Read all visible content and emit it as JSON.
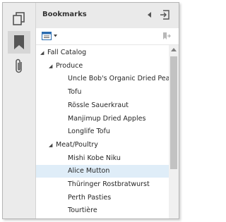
{
  "rail": {
    "buttons": [
      {
        "name": "thumbnails-icon"
      },
      {
        "name": "bookmark-icon"
      },
      {
        "name": "attachment-icon"
      }
    ]
  },
  "header": {
    "title": "Bookmarks"
  },
  "toolbar": {
    "options_icon": "bookmark-options-icon",
    "goto_icon": "go-to-bookmark-icon"
  },
  "tree": [
    {
      "label": "Fall Catalog",
      "level": 0,
      "caret": "expanded"
    },
    {
      "label": "Produce",
      "level": 1,
      "caret": "expanded"
    },
    {
      "label": "Uncle Bob's Organic Dried Pears",
      "level": 2
    },
    {
      "label": "Tofu",
      "level": 2
    },
    {
      "label": "Rössle Sauerkraut",
      "level": 2
    },
    {
      "label": "Manjimup Dried Apples",
      "level": 2
    },
    {
      "label": "Longlife Tofu",
      "level": 2
    },
    {
      "label": "Meat/Poultry",
      "level": 1,
      "caret": "expanded"
    },
    {
      "label": "Mishi Kobe Niku",
      "level": 2
    },
    {
      "label": "Alice Mutton",
      "level": 2,
      "selected": true
    },
    {
      "label": "Thüringer Rostbratwurst",
      "level": 2
    },
    {
      "label": "Perth Pasties",
      "level": 2
    },
    {
      "label": "Tourtière",
      "level": 2
    }
  ]
}
